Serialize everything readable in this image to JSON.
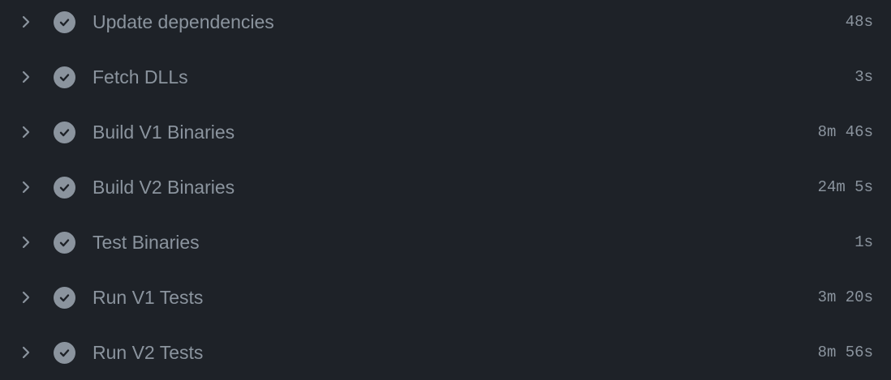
{
  "colors": {
    "background": "#1e2228",
    "text": "#8b949e",
    "icon": "#8b949e"
  },
  "icons": {
    "expand": "chevron-right-icon",
    "status": "check-circle-icon"
  },
  "steps": [
    {
      "label": "Update dependencies",
      "duration": "48s"
    },
    {
      "label": "Fetch DLLs",
      "duration": "3s"
    },
    {
      "label": "Build V1 Binaries",
      "duration": "8m 46s"
    },
    {
      "label": "Build V2 Binaries",
      "duration": "24m 5s"
    },
    {
      "label": "Test Binaries",
      "duration": "1s"
    },
    {
      "label": "Run V1 Tests",
      "duration": "3m 20s"
    },
    {
      "label": "Run V2 Tests",
      "duration": "8m 56s"
    }
  ]
}
